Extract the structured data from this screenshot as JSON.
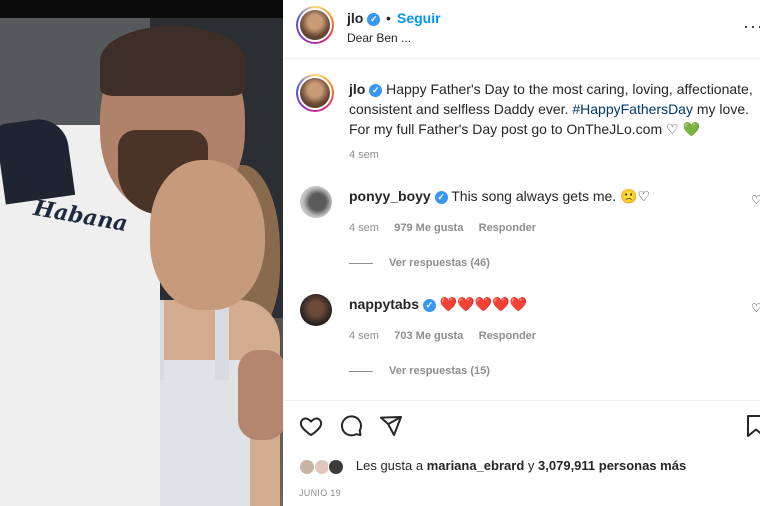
{
  "header": {
    "username": "jlo",
    "separator": "•",
    "follow_label": "Seguir",
    "subtitle": "Dear Ben ...",
    "more_icon": "more-horizontal-icon"
  },
  "caption": {
    "username": "jlo",
    "text_1": "Happy Father's Day to the most caring, loving, affectionate, consistent and selfless Daddy ever.",
    "hashtag": "#HappyFathersDay",
    "text_2": "my love. For my full Father's Day post go to OnTheJLo.com",
    "emoji": "♡ 💚",
    "time": "4 sem"
  },
  "comments": [
    {
      "username": "ponyy_boyy",
      "text": "This song always gets me. 🙁♡",
      "time": "4 sem",
      "likes": "979 Me gusta",
      "reply_label": "Responder",
      "view_replies": "Ver respuestas (46)"
    },
    {
      "username": "nappytabs",
      "text": "❤️❤️❤️❤️❤️",
      "time": "4 sem",
      "likes": "703 Me gusta",
      "reply_label": "Responder",
      "view_replies": "Ver respuestas (15)"
    }
  ],
  "footer": {
    "likes_prefix": "Les gusta a",
    "likes_user": "mariana_ebrard",
    "likes_and": "y",
    "likes_count": "3,079,911 personas más",
    "date": "JUNIO 19"
  },
  "photo": {
    "shirt_text": "Habana"
  },
  "colors": {
    "accent": "#0095f6",
    "verified": "#3897f0",
    "muted": "#8e8e8e"
  }
}
